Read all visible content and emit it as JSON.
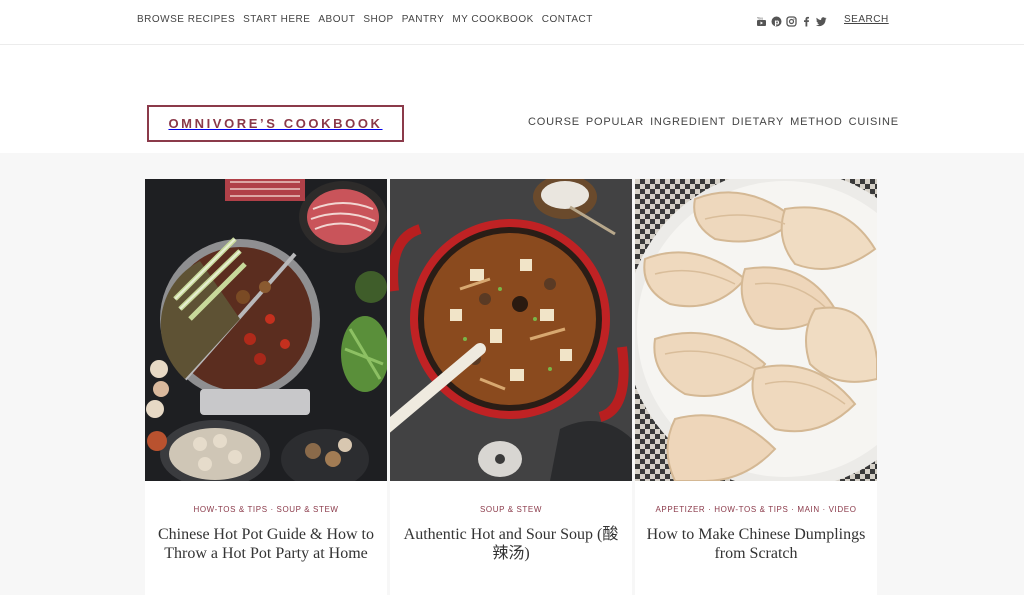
{
  "topnav": {
    "items": [
      "BROWSE RECIPES",
      "START HERE",
      "ABOUT",
      "SHOP",
      "PANTRY",
      "MY COOKBOOK",
      "CONTACT"
    ],
    "search_label": "SEARCH",
    "social_icons": [
      "youtube-icon",
      "pinterest-icon",
      "instagram-icon",
      "facebook-icon",
      "twitter-icon"
    ]
  },
  "header": {
    "logo_text": "OMNIVORE’S COOKBOOK",
    "categories": [
      "COURSE",
      "POPULAR",
      "INGREDIENT",
      "DIETARY",
      "METHOD",
      "CUISINE"
    ]
  },
  "colors": {
    "brand": "#8b3a4a",
    "background": "#f7f7f7",
    "text": "#333333"
  },
  "cards": [
    {
      "meta": "HOW-TOS & TIPS · SOUP & STEW",
      "title": "Chinese Hot Pot Guide & How to Throw a Hot Pot Party at Home",
      "image": "hot-pot-photo"
    },
    {
      "meta": "SOUP & STEW",
      "title": "Authentic Hot and Sour Soup (酸辣汤)",
      "image": "hot-and-sour-soup-photo"
    },
    {
      "meta": "APPETIZER · HOW-TOS & TIPS · MAIN · VIDEO",
      "title": "How to Make Chinese Dumplings from Scratch",
      "image": "dumplings-photo"
    }
  ]
}
